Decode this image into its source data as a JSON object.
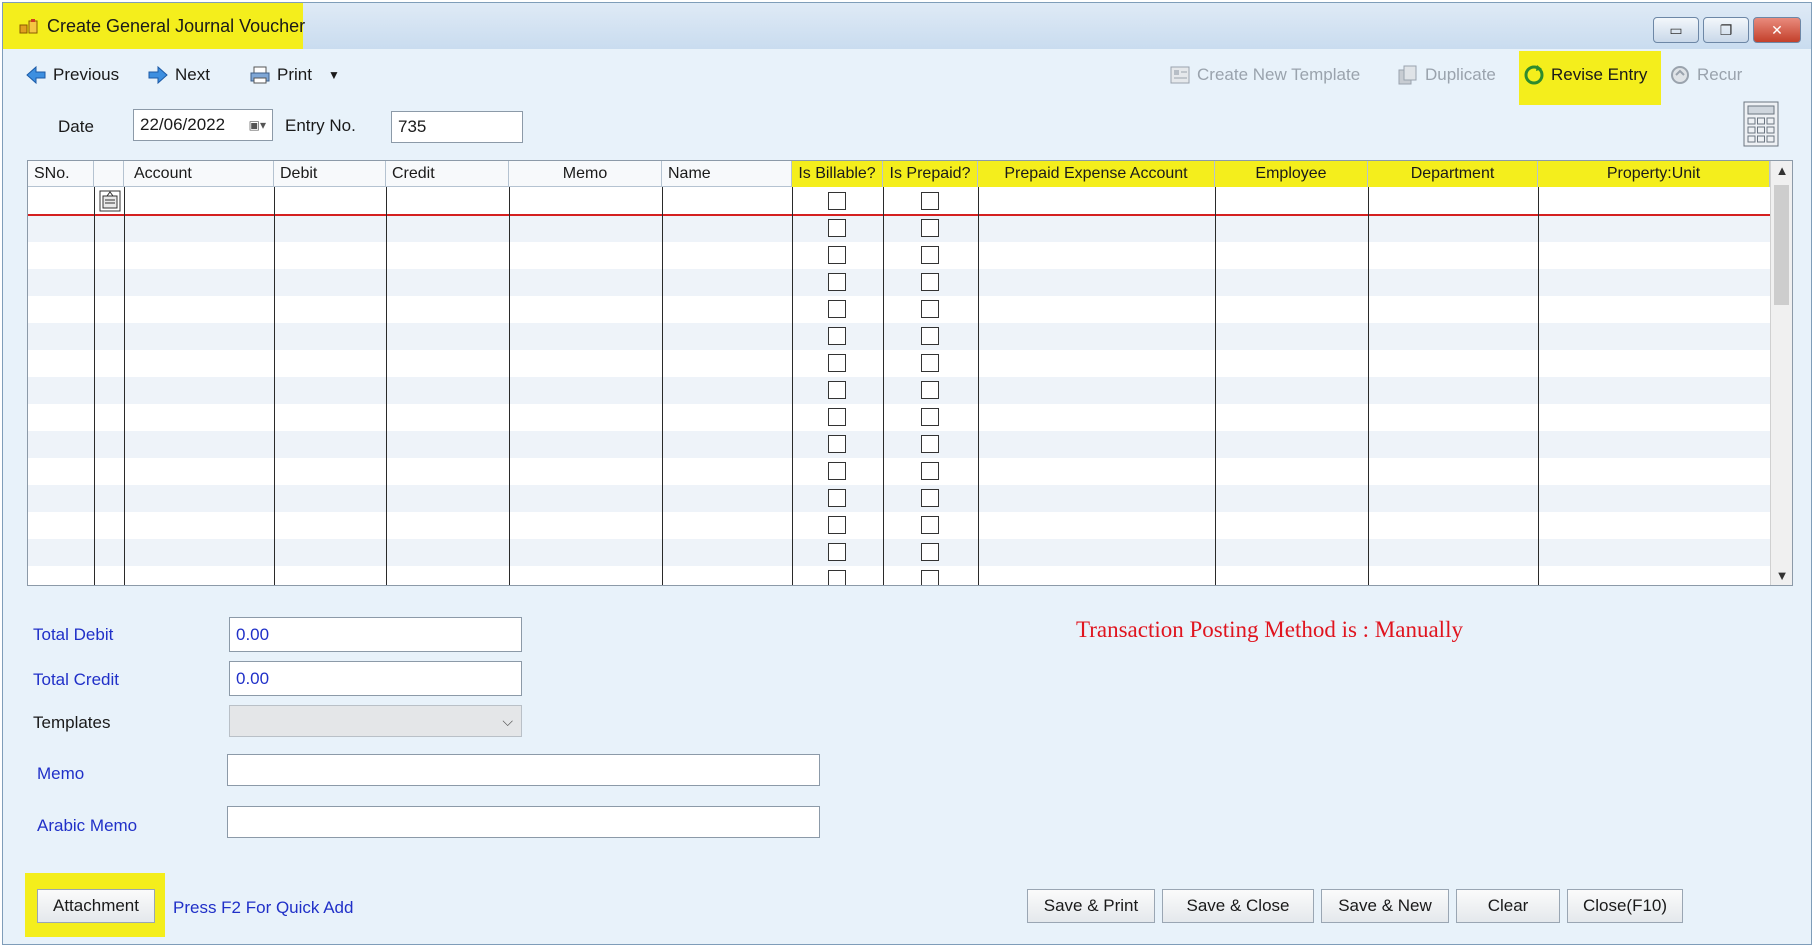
{
  "window": {
    "title": "Create General Journal Voucher",
    "controls": [
      "▭",
      "❐",
      "✕"
    ]
  },
  "toolbar": {
    "previous": "Previous",
    "next": "Next",
    "print": "Print",
    "create_template": "Create New Template",
    "duplicate": "Duplicate",
    "revise_entry": "Revise Entry",
    "recur": "Recur"
  },
  "header": {
    "date_label": "Date",
    "date_value": "22/06/2022",
    "entry_label": "Entry No.",
    "entry_value": "735"
  },
  "grid": {
    "columns": [
      "SNo.",
      "",
      "Account",
      "Debit",
      "Credit",
      "Memo",
      "Name",
      "Is Billable?",
      "Is Prepaid?",
      "Prepaid Expense Account",
      "Employee",
      "Department",
      "Property:Unit"
    ],
    "highlighted_columns": [
      "Is Billable?",
      "Is Prepaid?",
      "Prepaid Expense Account",
      "Employee",
      "Department",
      "Property:Unit"
    ],
    "row_count": 15
  },
  "totals": {
    "debit_label": "Total Debit",
    "debit_value": "0.00",
    "credit_label": "Total Credit",
    "credit_value": "0.00",
    "templates_label": "Templates",
    "memo_label": "Memo",
    "arabic_memo_label": "Arabic Memo"
  },
  "posting_method": "Transaction Posting Method is : Manually",
  "footer": {
    "attachment": "Attachment",
    "quick_add": "Press F2 For Quick Add",
    "save_print": "Save & Print",
    "save_close": "Save & Close",
    "save_new": "Save & New",
    "clear": "Clear",
    "close": "Close(F10)"
  },
  "colors": {
    "highlight": "#f4ee1c",
    "label_blue": "#2030c8",
    "posting_red": "#e0141e"
  }
}
